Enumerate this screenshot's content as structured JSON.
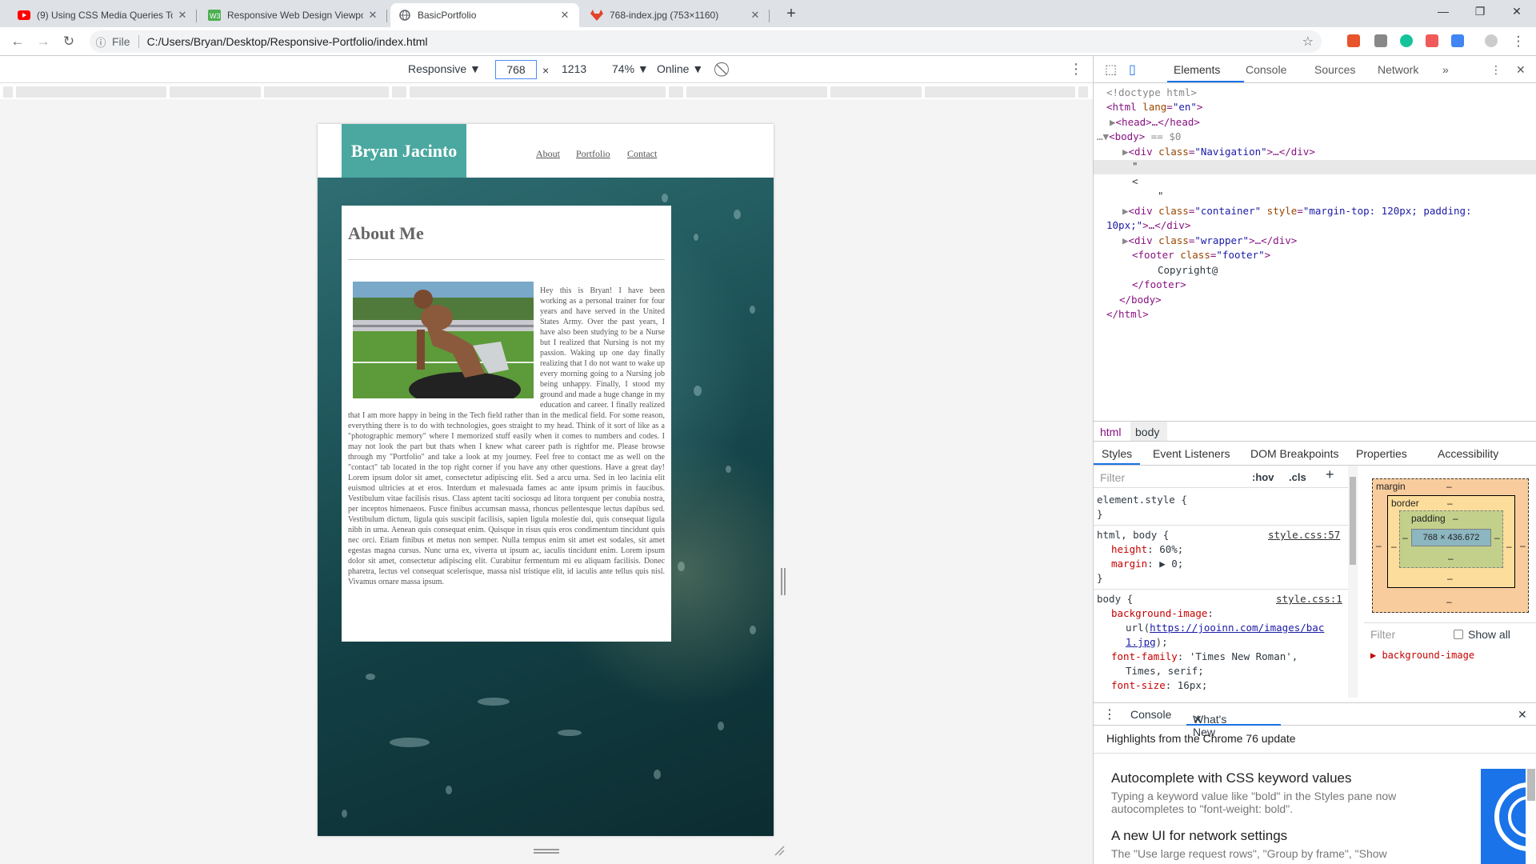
{
  "browser": {
    "tabs": [
      {
        "title": "(9) Using CSS Media Queries To C",
        "favicon": "youtube-icon",
        "color": "#ff0000"
      },
      {
        "title": "Responsive Web Design Viewpor",
        "favicon": "w3schools-icon",
        "color": "#4caf50"
      },
      {
        "title": "BasicPortfolio",
        "favicon": "globe-icon",
        "color": "#5f6368"
      },
      {
        "title": "768-index.jpg (753×1160)",
        "favicon": "gitlab-icon",
        "color": "#e24329"
      }
    ],
    "url_scheme": "File",
    "url": "C:/Users/Bryan/Desktop/Responsive-Portfolio/index.html"
  },
  "device_toolbar": {
    "mode": "Responsive ▼",
    "width": "768",
    "times": "×",
    "height": "1213",
    "zoom": "74% ▼",
    "network": "Online ▼"
  },
  "site": {
    "brand": "Bryan Jacinto",
    "nav": [
      "About",
      "Portfolio",
      "Contact"
    ],
    "about_title": "About Me",
    "about_text": "Hey this is Bryan! I have been working as a personal trainer for four years and have served in the United States Army. Over the past years, I have also been studying to be a Nurse but I realized that Nursing is not my passion. Waking up one day finally realizing that I do not want to wake up every morning going to a Nursing job being unhappy. Finally, I stood my ground and made a huge change in my education and career. I finally realized that I am more happy in being in the Tech field rather than in the medical field. For some reason, everything there is to do with technologies, goes straight to my head. Think of it sort of like as a \"photographic memory\" where I memorized stuff easily when it comes to numbers and codes. I may not look the part but thats when I knew what career path is rightfor me. Please browse through my \"Portfolio\" and take a look at my journey. Feel free to contact me as well on the \"contact\" tab located in the top right corner if you have any other questions. Have a great day! Lorem ipsum dolor sit amet, consectetur adipiscing elit. Sed a arcu urna. Sed in leo lacinia elit euismod ultricies at et eros. Interdum et malesuada fames ac ante ipsum primis in faucibus. Vestibulum vitae facilisis risus. Class aptent taciti sociosqu ad litora torquent per conubia nostra, per inceptos himenaeos. Fusce finibus accumsan massa, rhoncus pellentesque lectus dapibus sed. Vestibulum dictum, ligula quis suscipit facilisis, sapien ligula molestie dui, quis consequat ligula nibh in urna. Aenean quis consequat enim. Quisque in risus quis eros condimentum tincidunt quis nec orci. Etiam finibus et metus non semper. Nulla tempus enim sit amet est sodales, sit amet egestas magna cursus. Nunc urna ex, viverra ut ipsum ac, iaculis tincidunt enim. Lorem ipsum dolor sit amet, consectetur adipiscing elit. Curabitur fermentum mi eu aliquam facilisis. Donec pharetra, lectus vel consequat scelerisque, massa nisl tristique elit, id iaculis ante tellus quis nisl. Vivamus ornare massa ipsum."
  },
  "devtools": {
    "tabs": [
      "Elements",
      "Console",
      "Sources",
      "Network"
    ],
    "more": "»",
    "dom": {
      "doctype": "<!doctype html>",
      "html_open_tag": "<html",
      "lang_attr": "lang",
      "lang_val": "\"en\"",
      "head": "<head>…</head>",
      "body_open": "<body>",
      "body_marker": "== $0",
      "nav_div_tag": "<div",
      "class_attr": "class",
      "nav_class": "\"Navigation\"",
      "div_close": ">…</div>",
      "quote": "\"",
      "lt": "<",
      "container_class": "\"container\"",
      "style_attr": "style",
      "container_style": "\"margin-top: 120px; padding:",
      "container_style_cont": "10px;\"",
      "wrapper_class": "\"wrapper\"",
      "footer_tag": "<footer",
      "footer_class": "\"footer\"",
      "gt": ">",
      "footer_text": "Copyright@",
      "footer_close": "</footer>",
      "body_close": "</body>",
      "html_close": "</html>"
    },
    "breadcrumbs": [
      "html",
      "body"
    ],
    "style_tabs": [
      "Styles",
      "Event Listeners",
      "DOM Breakpoints",
      "Properties",
      "Accessibility"
    ],
    "filter_placeholder": "Filter",
    "hov": ":hov",
    "cls": ".cls",
    "plus": "+",
    "rules": {
      "element_style": "element.style {",
      "close": "}",
      "html_body_sel": "html, body {",
      "html_body_src": "style.css:57",
      "height_prop": "height",
      "height_val": ": 60%;",
      "margin_prop": "margin",
      "margin_val": ": ▶ 0;",
      "body_sel": "body {",
      "body_src": "style.css:1",
      "bg_prop": "background-image",
      "colon": ":",
      "url_prefix": "url(",
      "url_link": "https://jooinn.com/images/bac",
      "url_link2": "1.jpg",
      "url_suffix": ");",
      "font_prop": "font-family",
      "font_val": ": 'Times New Roman',",
      "font_val2": "Times, serif;",
      "size_prop": "font-size",
      "size_val": ": 16px;"
    },
    "box_model": {
      "margin": "margin",
      "border": "border",
      "padding": "padding",
      "dash": "–",
      "content": "768 × 436.672"
    },
    "computed_filter": "Filter",
    "show_all": "Show all",
    "computed_first": "▶ background-image",
    "drawer_tabs": [
      "Console",
      "What's New"
    ],
    "whats_new": {
      "highlights": "Highlights from the Chrome 76 update",
      "items": [
        {
          "title": "Autocomplete with CSS keyword values",
          "desc": "Typing a keyword value like \"bold\" in the Styles pane now autocompletes to \"font-weight: bold\"."
        },
        {
          "title": "A new UI for network settings",
          "desc": "The \"Use large request rows\", \"Group by frame\", \"Show"
        }
      ]
    }
  },
  "colors": {
    "brand_teal": "#4aa8a0",
    "devtools_blue": "#1a73e8"
  }
}
